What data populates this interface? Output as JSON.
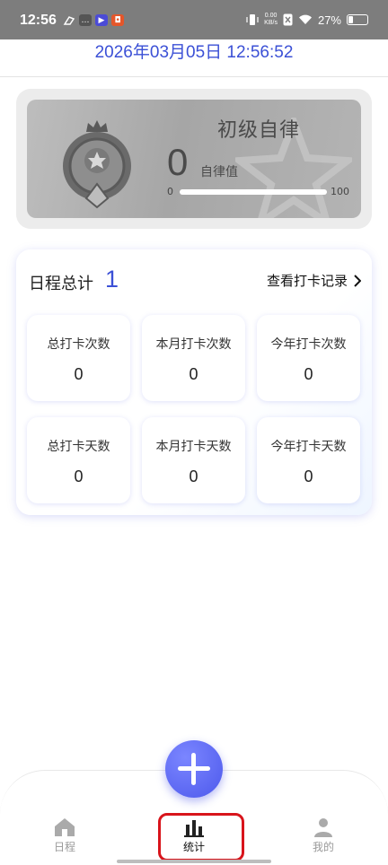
{
  "status_bar": {
    "time": "12:56",
    "net_speed_value": "0.00",
    "net_speed_unit": "KB/s",
    "battery": "27%"
  },
  "datetime": "2026年03月05日 12:56:52",
  "level_card": {
    "title": "初级自律",
    "score": "0",
    "score_label": "自律值",
    "range_min": "0",
    "range_max": "100",
    "progress_fraction": 0
  },
  "summary": {
    "title": "日程总计",
    "count": "1",
    "link_label": "查看打卡记录",
    "stats": [
      {
        "label": "总打卡次数",
        "value": "0"
      },
      {
        "label": "本月打卡次数",
        "value": "0"
      },
      {
        "label": "今年打卡次数",
        "value": "0"
      },
      {
        "label": "总打卡天数",
        "value": "0"
      },
      {
        "label": "本月打卡天数",
        "value": "0"
      },
      {
        "label": "今年打卡天数",
        "value": "0"
      }
    ]
  },
  "tabs": [
    {
      "label": "日程",
      "icon": "home-icon"
    },
    {
      "label": "统计",
      "icon": "bar-chart-icon",
      "active": true
    },
    {
      "label": "我的",
      "icon": "person-icon"
    }
  ],
  "colors": {
    "accent": "#3b50d6",
    "fab": "#5662f0",
    "highlight": "#d8141b"
  }
}
